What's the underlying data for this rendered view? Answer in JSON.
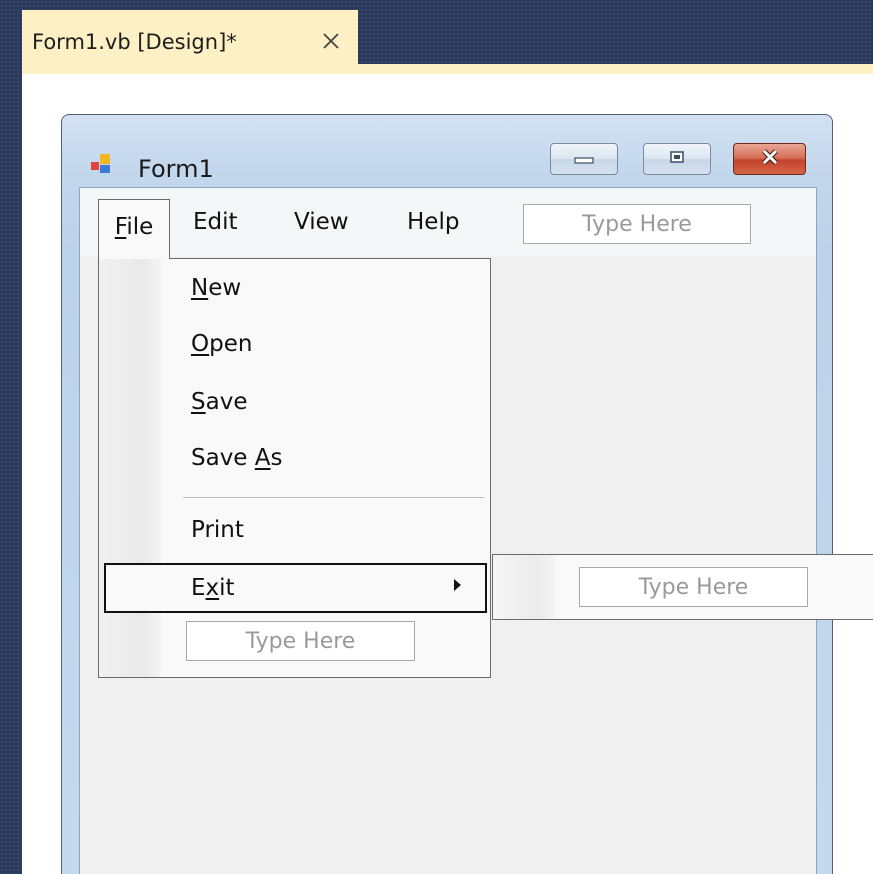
{
  "document_tab": {
    "title": "Form1.vb [Design]*",
    "close_icon": "close-icon"
  },
  "form": {
    "title": "Form1",
    "icon": "form-app-icon",
    "caption_buttons": [
      "minimize-icon",
      "maximize-icon",
      "close-icon"
    ]
  },
  "menubar": {
    "items": [
      {
        "label_pre": "",
        "label_u": "F",
        "label_post": "ile"
      },
      {
        "label": "Edit"
      },
      {
        "label": "View"
      },
      {
        "label": "Help"
      }
    ],
    "type_here": "Type Here"
  },
  "file_menu": {
    "items": [
      {
        "label_pre": "",
        "label_u": "N",
        "label_post": "ew"
      },
      {
        "label_pre": "",
        "label_u": "O",
        "label_post": "pen"
      },
      {
        "label_pre": "",
        "label_u": "S",
        "label_post": "ave"
      },
      {
        "label_pre": "Save ",
        "label_u": "A",
        "label_post": "s"
      },
      {
        "label": "Print"
      },
      {
        "label_pre": "E",
        "label_u": "x",
        "label_post": "it",
        "has_submenu": true
      }
    ],
    "type_here": "Type Here"
  },
  "exit_submenu": {
    "type_here": "Type Here"
  },
  "colors": {
    "tab_background": "#fdf0c4",
    "ide_background": "#2b3a5a",
    "form_frame": "#c2d6ec",
    "client_area": "#f0f0f0",
    "close_button": "#c2432b"
  }
}
